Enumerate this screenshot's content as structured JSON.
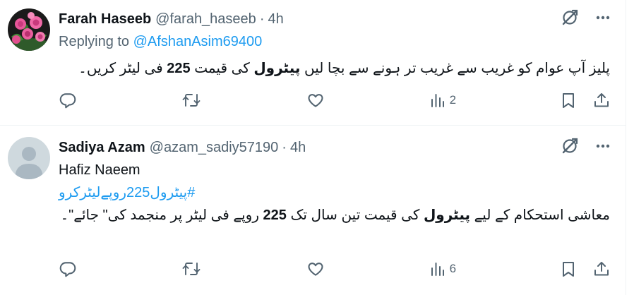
{
  "tweets": [
    {
      "name": "Farah Haseeb",
      "handle": "@farah_haseeb",
      "dot": "·",
      "time": "4h",
      "replying_prefix": "Replying to",
      "replying_to": "@AfshanAsim69400",
      "body_pre": "پلیز آپ عوام کو غریب سے غریب تر ہونے سے بچا لیں ",
      "body_bold1": "پیٹرول",
      "body_mid": " کی قیمت ",
      "body_bold2": "225",
      "body_post": " فی لیٹر کریں۔",
      "views": "2",
      "avatar": "roses-avatar"
    },
    {
      "name": "Sadiya Azam",
      "handle": "@azam_sadiy57190",
      "dot": "·",
      "time": "4h",
      "line1": "Hafiz Naeem",
      "hashtag": "#پیٹرول225روپےلیٹرکرو",
      "body_pre": "معاشی استحکام کے لیے ",
      "body_bold1": "پیٹرول",
      "body_mid": " کی قیمت تین سال تک ",
      "body_bold2": "225",
      "body_post": " روپے فی لیٹر پر منجمد کی\" جائے\"۔",
      "views": "6",
      "avatar": "default-avatar"
    }
  ],
  "icons": {
    "header": [
      "grok-strike-icon",
      "more-icon"
    ],
    "actions": [
      "reply-icon",
      "retweet-icon",
      "like-icon",
      "views-icon",
      "bookmark-icon",
      "share-icon"
    ]
  },
  "colors": {
    "accent": "#1d9bf0",
    "muted": "#536471",
    "text": "#0f1419",
    "divider": "#eff3f4"
  }
}
